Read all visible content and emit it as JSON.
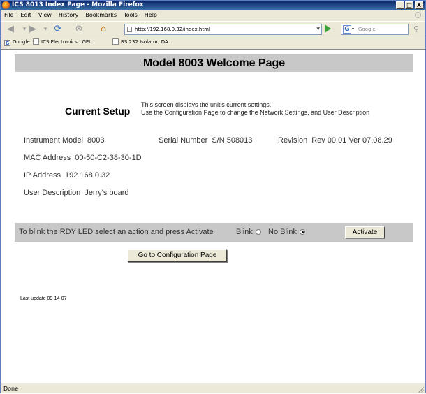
{
  "window": {
    "title": "ICS 8013 Index Page - Mozilla Firefox",
    "min_label": "_",
    "max_label": "□",
    "close_label": "X"
  },
  "menu": {
    "items": [
      "File",
      "Edit",
      "View",
      "History",
      "Bookmarks",
      "Tools",
      "Help"
    ]
  },
  "nav": {
    "url": "http://192.168.0.32/index.html",
    "search_placeholder": "Google"
  },
  "bookmarks": [
    {
      "label": "Google",
      "icon": "google-icon"
    },
    {
      "label": "ICS Electronics ..GPI...",
      "icon": "page-icon"
    },
    {
      "label": "RS 232 Isolator, DA...",
      "icon": "page-icon"
    }
  ],
  "page": {
    "heading": "Model 8003 Welcome Page",
    "current_setup": "Current Setup",
    "desc_line1": "This screen displays the unit's current settings.",
    "desc_line2": "Use the Configuration Page to change the Network Settings, and User Description",
    "instrument_model_label": "Instrument Model",
    "instrument_model_value": "8003",
    "serial_label": "Serial Number",
    "serial_value": "S/N 508013",
    "revision_label": "Revision",
    "revision_value": "Rev 00.01 Ver 07.08.29",
    "mac_label": "MAC Address",
    "mac_value": "00-50-C2-38-30-1D",
    "ip_label": "IP Address",
    "ip_value": "192.168.0.32",
    "user_desc_label": "User Description",
    "user_desc_value": "Jerry's board",
    "blink_instruction": "To blink the RDY LED select an action and press Activate",
    "blink_option": "Blink",
    "no_blink_option": "No Blink",
    "selected_option": "No Blink",
    "activate_label": "Activate",
    "config_button_label": "Go to Configuration Page",
    "last_update": "Last update 09-14-07"
  },
  "status": {
    "text": "Done"
  }
}
